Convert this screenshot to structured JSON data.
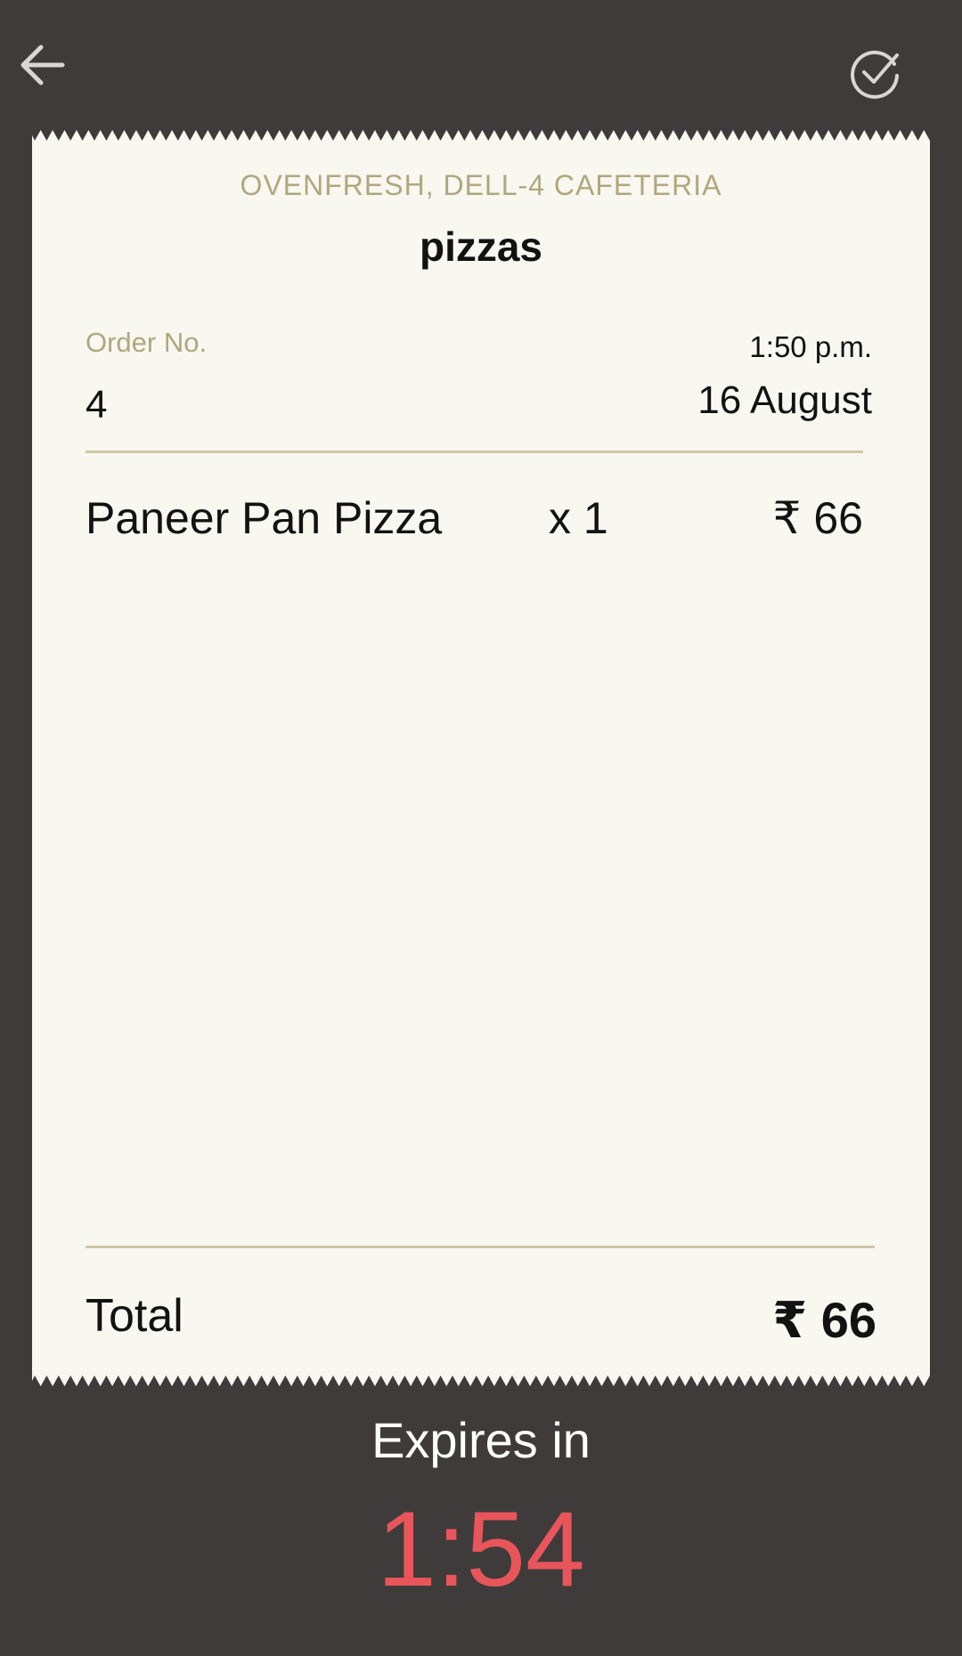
{
  "header": {
    "back_icon": "arrow-left-icon",
    "confirm_icon": "check-circle-icon"
  },
  "receipt": {
    "vendor": "OVENFRESH, DELL-4 CAFETERIA",
    "category": "pizzas",
    "order_label": "Order No.",
    "order_number": "4",
    "time": "1:50 p.m.",
    "date": "16 August",
    "items": [
      {
        "name": "Paneer Pan Pizza",
        "qty": "x 1",
        "price": "₹ 66"
      }
    ],
    "total_label": "Total",
    "total_value": "₹ 66"
  },
  "expiry": {
    "label": "Expires in",
    "countdown": "1:54"
  },
  "colors": {
    "background": "#3f3b3b",
    "receipt": "#f8f7f0",
    "muted_gold": "#b1a77e",
    "timer_red": "#e8555a"
  }
}
